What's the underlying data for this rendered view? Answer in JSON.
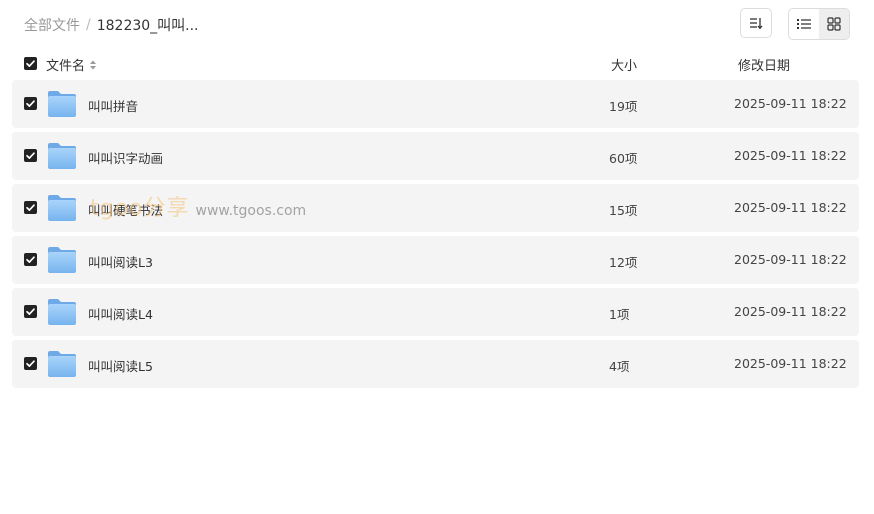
{
  "breadcrumb": {
    "root": "全部文件",
    "separator": "/",
    "current": "182230_叫叫..."
  },
  "toolbar": {
    "sort_icon": "sort-icon",
    "list_icon": "list-view-icon",
    "grid_icon": "grid-view-icon"
  },
  "header": {
    "name": "文件名",
    "size": "大小",
    "date": "修改日期"
  },
  "rows": [
    {
      "name": "叫叫拼音",
      "size": "19项",
      "date": "2025-09-11 18:22"
    },
    {
      "name": "叫叫识字动画",
      "size": "60项",
      "date": "2025-09-11 18:22"
    },
    {
      "name": "叫叫硬笔书法",
      "size": "15项",
      "date": "2025-09-11 18:22"
    },
    {
      "name": "叫叫阅读L3",
      "size": "12项",
      "date": "2025-09-11 18:22"
    },
    {
      "name": "叫叫阅读L4",
      "size": "1项",
      "date": "2025-09-11 18:22"
    },
    {
      "name": "叫叫阅读L5",
      "size": "4项",
      "date": "2025-09-11 18:22"
    }
  ],
  "watermark": {
    "logo": "tgoo分享",
    "url": "www.tgoos.com"
  },
  "colors": {
    "row_bg": "#f4f4f4",
    "folder_blue": "#8cc3f3",
    "checkbox": "#222222"
  }
}
